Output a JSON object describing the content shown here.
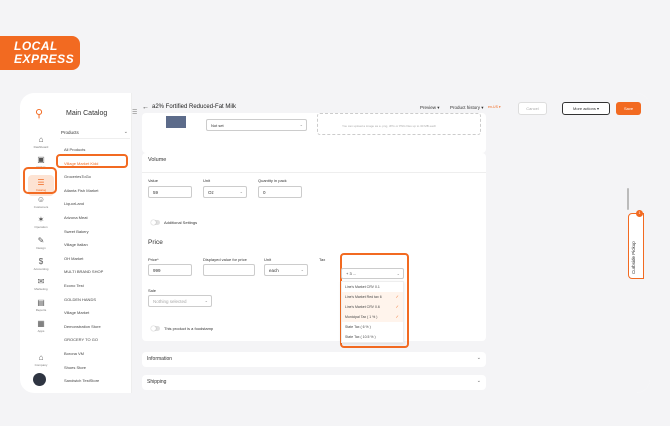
{
  "brand": {
    "logo_line1": "LOCAL",
    "logo_line2": "EXPRESS",
    "accent": "#f26a21"
  },
  "rail": [
    {
      "name": "rail-dashboard",
      "label": "Dashboard",
      "icon": "home-icon"
    },
    {
      "name": "rail-orders",
      "label": "Orders",
      "icon": "bag-icon"
    },
    {
      "name": "rail-catalog",
      "label": "Catalog",
      "icon": "catalog-icon",
      "active": true
    },
    {
      "name": "rail-customers",
      "label": "Customers",
      "icon": "users-icon"
    },
    {
      "name": "rail-operation",
      "label": "Operation",
      "icon": "operation-icon"
    },
    {
      "name": "rail-design",
      "label": "Design",
      "icon": "design-icon"
    },
    {
      "name": "rail-accounting",
      "label": "Accounting",
      "icon": "accounting-icon"
    },
    {
      "name": "rail-marketing",
      "label": "Marketing",
      "icon": "marketing-icon"
    },
    {
      "name": "rail-reports",
      "label": "Reports",
      "icon": "reports-icon"
    },
    {
      "name": "rail-apps",
      "label": "Apps",
      "icon": "apps-icon"
    },
    {
      "name": "rail-company",
      "label": "Company",
      "icon": "company-icon"
    }
  ],
  "catalog": {
    "title": "Main Catalog",
    "section": "Products",
    "items": [
      "All Products",
      "Village Market Kidd",
      "GroceriesToGo",
      "Atlanta Fish Market",
      "LiquorLand",
      "Arizona Meat",
      "Sweet Bakery",
      "Village Italian",
      "OH Market",
      "MULTI BRAND SHOP",
      "Econo Test",
      "GOLDEN HANDS",
      "Village Market",
      "Demonstration Store",
      "GROCERY TO GO",
      "Borona VM",
      "Shoes Store",
      "Sandwich TestStore"
    ],
    "selected_index": 1
  },
  "header": {
    "title": "a2% Fortified Reduced-Fat Milk",
    "preview": "Preview",
    "history": "Product history",
    "version": "en-US ▾",
    "cancel": "Cancel",
    "more": "More actions",
    "save": "Save"
  },
  "image_section": {
    "select_value": "Not set",
    "upload_note": "You can upload a image as a .png, JPG or PNG files up to 30 MB each"
  },
  "volume": {
    "title": "Volume",
    "value_label": "Value",
    "value": "59",
    "unit_label": "Unit",
    "unit": "Oz",
    "qty_label": "Quantity in pack",
    "qty": "0",
    "additional": "Additional Settings"
  },
  "price": {
    "title": "Price",
    "price_label": "Price*",
    "price_value": "999",
    "display_label": "Displayed value for price",
    "unit_label": "Unit",
    "unit_value": "each",
    "tax_label": "Tax",
    "tax_value": "+ 3 ...",
    "sale_label": "Sale",
    "sale_placeholder": "Nothing selected",
    "foodstamp": "This product is a foodstamp"
  },
  "tax_options": [
    {
      "label": "Line's Market CRV 0.1",
      "checked": false
    },
    {
      "label": "Line's Market Red tax 6",
      "checked": true
    },
    {
      "label": "Line's Market CRV 0.6",
      "checked": true
    },
    {
      "label": "Municipal Tax ( 1 % )",
      "checked": true
    },
    {
      "label": "State Tax ( 6 % )",
      "checked": false
    },
    {
      "label": "State Tax ( 10.5 % )",
      "checked": false
    }
  ],
  "accordions": {
    "information": "Information",
    "shipping": "Shipping"
  },
  "side_tab": {
    "label": "Curbside Pickup",
    "badge": "1"
  }
}
